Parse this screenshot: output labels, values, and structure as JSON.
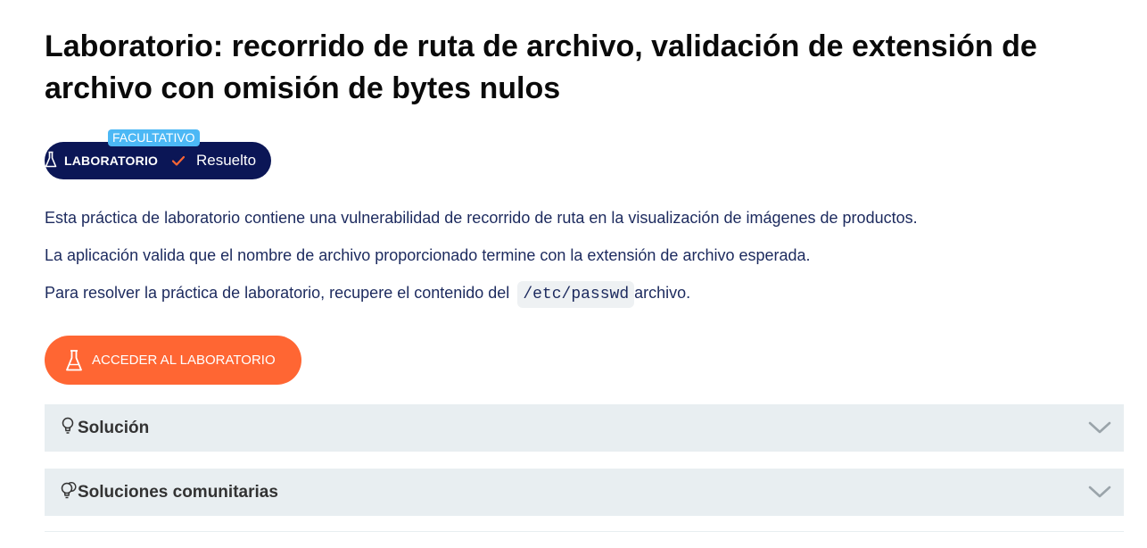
{
  "lab": {
    "title": "Laboratorio: recorrido de ruta de archivo, validación de extensión de archivo con omisión de bytes nulos",
    "badge": {
      "tag": "FACULTATIVO",
      "icon": "flask-icon",
      "label": "LABORATORIO",
      "status_icon": "checkmark-icon",
      "status": "Resuelto"
    },
    "description": {
      "p1": "Esta práctica de laboratorio contiene una vulnerabilidad de recorrido de ruta en la visualización de imágenes de productos.",
      "p2": "La aplicación valida que el nombre de archivo proporcionado termine con la extensión de archivo esperada.",
      "p3_before": "Para resolver la práctica de laboratorio, recupere el contenido del",
      "p3_code": "/etc/passwd",
      "p3_after": "archivo."
    },
    "access_button": {
      "icon": "flask-icon",
      "label": "ACCEDER AL LABORATORIO"
    },
    "accordions": [
      {
        "icon": "lightbulb-icon",
        "title": "Solución",
        "state": "collapsed"
      },
      {
        "icon": "lightbulbs-icon",
        "title": "Soluciones comunitarias",
        "state": "collapsed"
      }
    ]
  },
  "colors": {
    "badge_bg": "#0b1656",
    "badge_tag_bg": "#4cb8f5",
    "check": "#ff6633",
    "text_body": "#1c2a5e",
    "button_bg": "#ff6633",
    "accordion_bg": "#e8eef1"
  }
}
